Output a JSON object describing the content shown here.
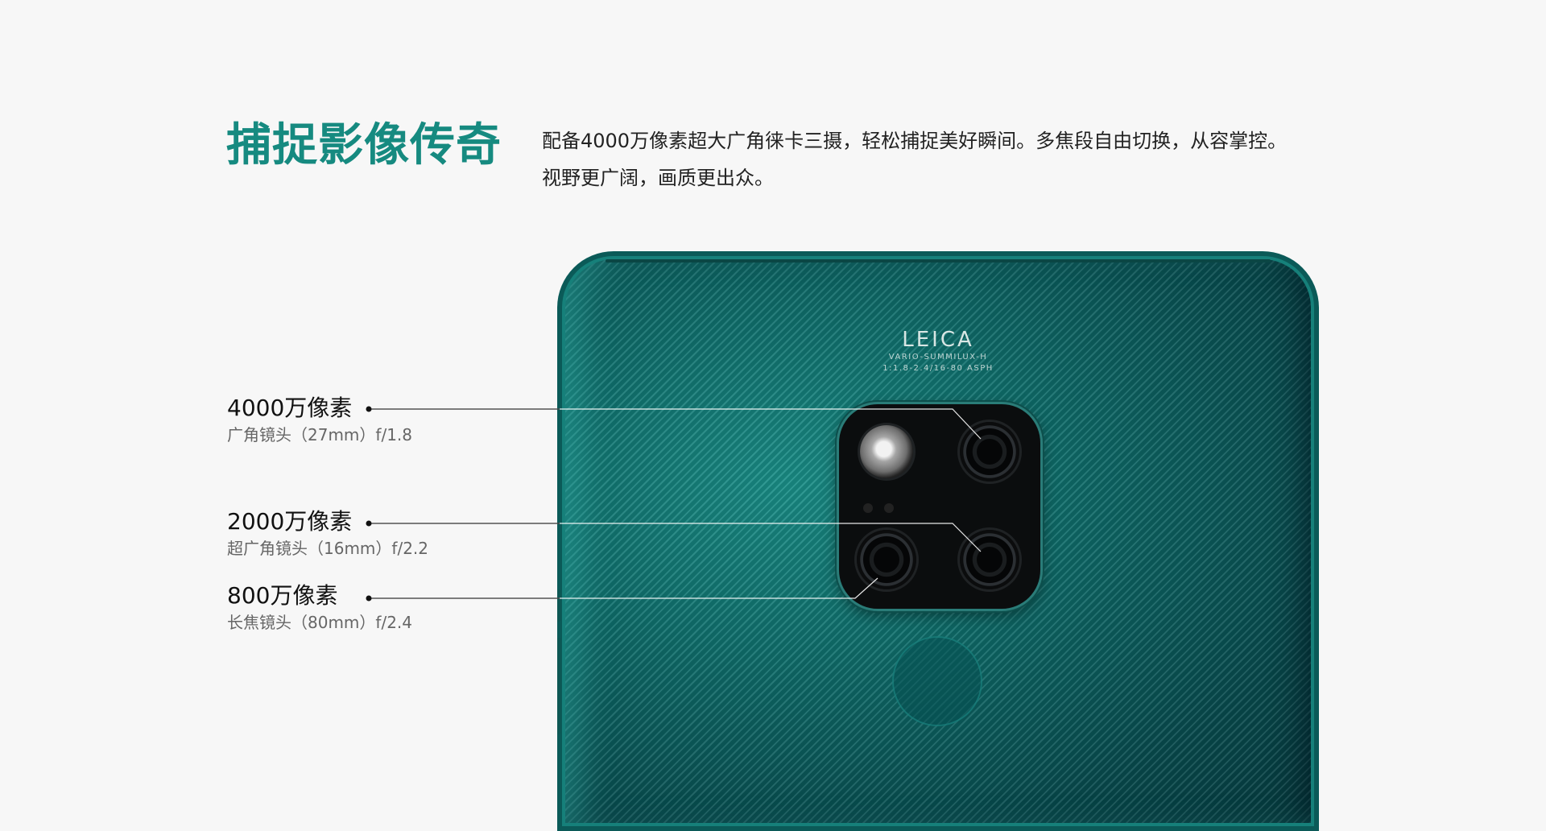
{
  "heading": {
    "title": "捕捉影像传奇",
    "desc_line1": "配备4000万像素超大广角徕卡三摄，轻松捕捉美好瞬间。多焦段自由切换，从容掌控。",
    "desc_line2": "视野更广阔，画质更出众。"
  },
  "specs": [
    {
      "megapixels": "4000万像素",
      "lens": "广角镜头（27mm）f/1.8"
    },
    {
      "megapixels": "2000万像素",
      "lens": "超广角镜头（16mm）f/2.2"
    },
    {
      "megapixels": "800万像素",
      "lens": "长焦镜头（80mm）f/2.4"
    }
  ],
  "phone": {
    "brand": "LEICA",
    "lens_line1": "VARIO-SUMMILUX-H",
    "lens_line2": "1:1.8-2.4/16-80 ASPH",
    "colors": {
      "accent": "#168a80",
      "body": "#0e6a68"
    }
  }
}
